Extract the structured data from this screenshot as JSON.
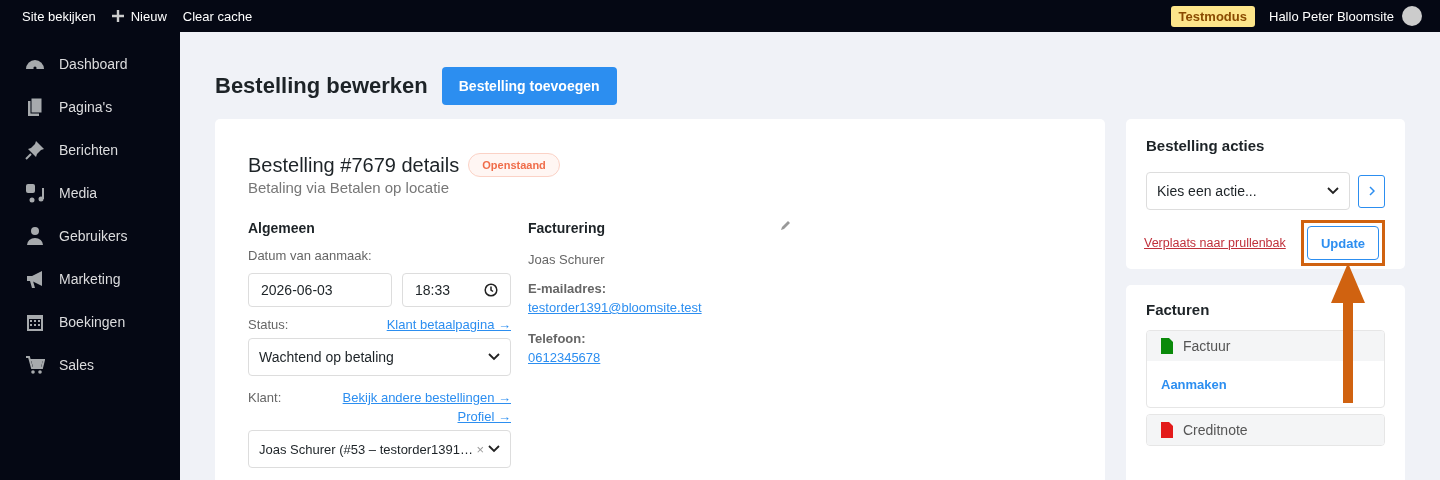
{
  "topbar": {
    "links": [
      "Site bekijken",
      "Nieuw",
      "Clear cache"
    ],
    "badge": "Testmodus",
    "greeting": "Hallo Peter Bloomsite"
  },
  "sidebar": {
    "items": [
      {
        "label": "Dashboard"
      },
      {
        "label": "Pagina's"
      },
      {
        "label": "Berichten"
      },
      {
        "label": "Media"
      },
      {
        "label": "Gebruikers"
      },
      {
        "label": "Marketing"
      },
      {
        "label": "Boekingen"
      },
      {
        "label": "Sales"
      }
    ]
  },
  "page": {
    "title": "Bestelling bewerken",
    "add_button": "Bestelling toevoegen"
  },
  "order": {
    "title": "Bestelling #7679 details",
    "status_badge": "Openstaand",
    "subtitle": "Betaling via Betalen op locatie",
    "general": {
      "heading": "Algemeen",
      "date_label": "Datum van aanmaak:",
      "date": "2026-06-03",
      "time": "18:33",
      "status_label": "Status:",
      "status_link": "Klant betaalpagina →",
      "status_value": "Wachtend op betaling",
      "customer_label": "Klant:",
      "customer_links": [
        "Bekijk andere bestellingen →",
        "Profiel →"
      ],
      "customer_value": "Joas Schurer (#53 – testorder1391…",
      "clear": "×"
    },
    "billing": {
      "heading": "Facturering",
      "name": "Joas Schurer",
      "email_label": "E-mailadres:",
      "email": "testorder1391@bloomsite.test",
      "phone_label": "Telefoon:",
      "phone": "0612345678"
    }
  },
  "actions": {
    "title": "Bestelling acties",
    "select": "Kies een actie...",
    "trash": "Verplaats naar prullenbak",
    "update": "Update",
    "highlighted": true
  },
  "invoices": {
    "title": "Facturen",
    "items": [
      {
        "label": "Factuur",
        "color": "#0a8a0a",
        "action": "Aanmaken"
      },
      {
        "label": "Creditnote",
        "color": "#e31b1b"
      }
    ]
  }
}
